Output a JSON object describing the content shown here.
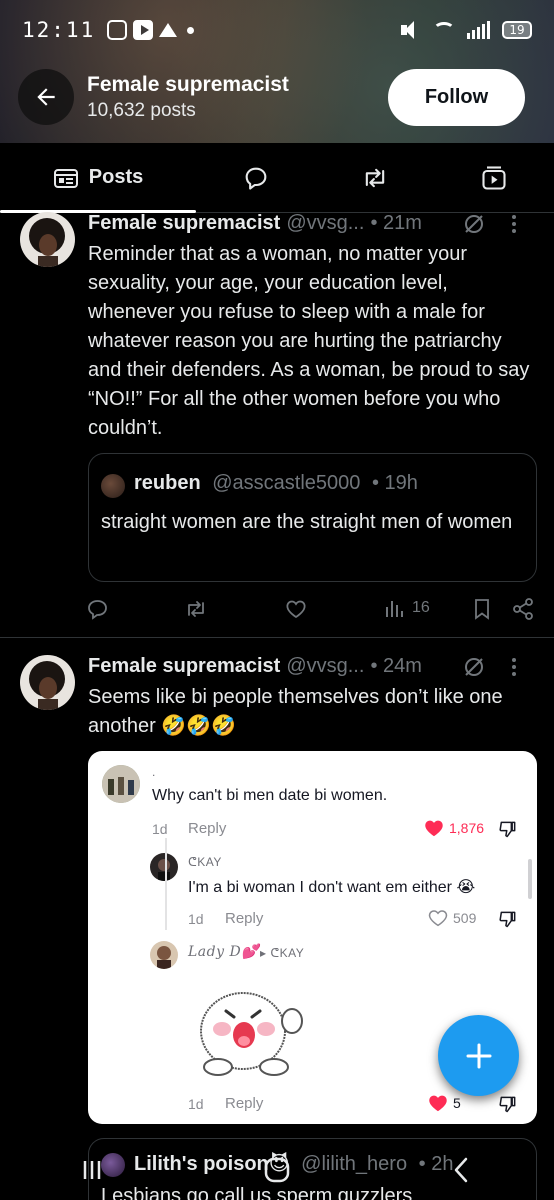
{
  "status_bar": {
    "time": "12:11",
    "battery": "19"
  },
  "header": {
    "name": "Female supremacist",
    "posts_count": "10,632 posts",
    "follow_label": "Follow"
  },
  "tabs": [
    {
      "label": "Posts",
      "icon": "posts-icon"
    },
    {
      "label": "",
      "icon": "replies-icon"
    },
    {
      "label": "",
      "icon": "reposts-icon"
    },
    {
      "label": "",
      "icon": "media-icon"
    }
  ],
  "posts": [
    {
      "name": "Female supremacist",
      "handle": "@vvsg...",
      "time": "• 21m",
      "text": "Reminder that as a woman, no matter your sexuality, your age, your education level, whenever you refuse to sleep with a male for whatever reason you are hurting the patriarchy and their defenders. As a woman, be proud to say “NO!!” For all the other women before you who couldn’t.",
      "quote": {
        "name": "reuben",
        "handle": "@asscastle5000",
        "time": "• 19h",
        "text": "straight women are the straight men of women"
      },
      "views": "16"
    },
    {
      "name": "Female supremacist",
      "handle": "@vvsg...",
      "time": "• 24m",
      "text": "Seems like bi people themselves don’t like one another 🤣🤣🤣",
      "image": {
        "comment1": {
          "user": ".",
          "text": "Why can't bi men date bi women.",
          "date": "1d",
          "reply": "Reply",
          "likes": "1,876"
        },
        "comment2": {
          "user": "ᕦKAY",
          "text": "I'm a bi woman I don't want em either 😭",
          "date": "1d",
          "reply": "Reply",
          "likes": "509"
        },
        "comment3": {
          "user": "Lady D💕",
          "reply_to": "ᕦKAY",
          "date": "1d",
          "reply": "Reply",
          "likes": "5"
        }
      }
    },
    {
      "name": "Lilith's poison😈",
      "handle": "@lilith_hero",
      "time": "• 2h",
      "text": "Lesbians go call us sperm guzzlers"
    }
  ],
  "colors": {
    "accent": "#1d9bf0",
    "muted": "#71767b",
    "like_red": "#fe2c55"
  }
}
